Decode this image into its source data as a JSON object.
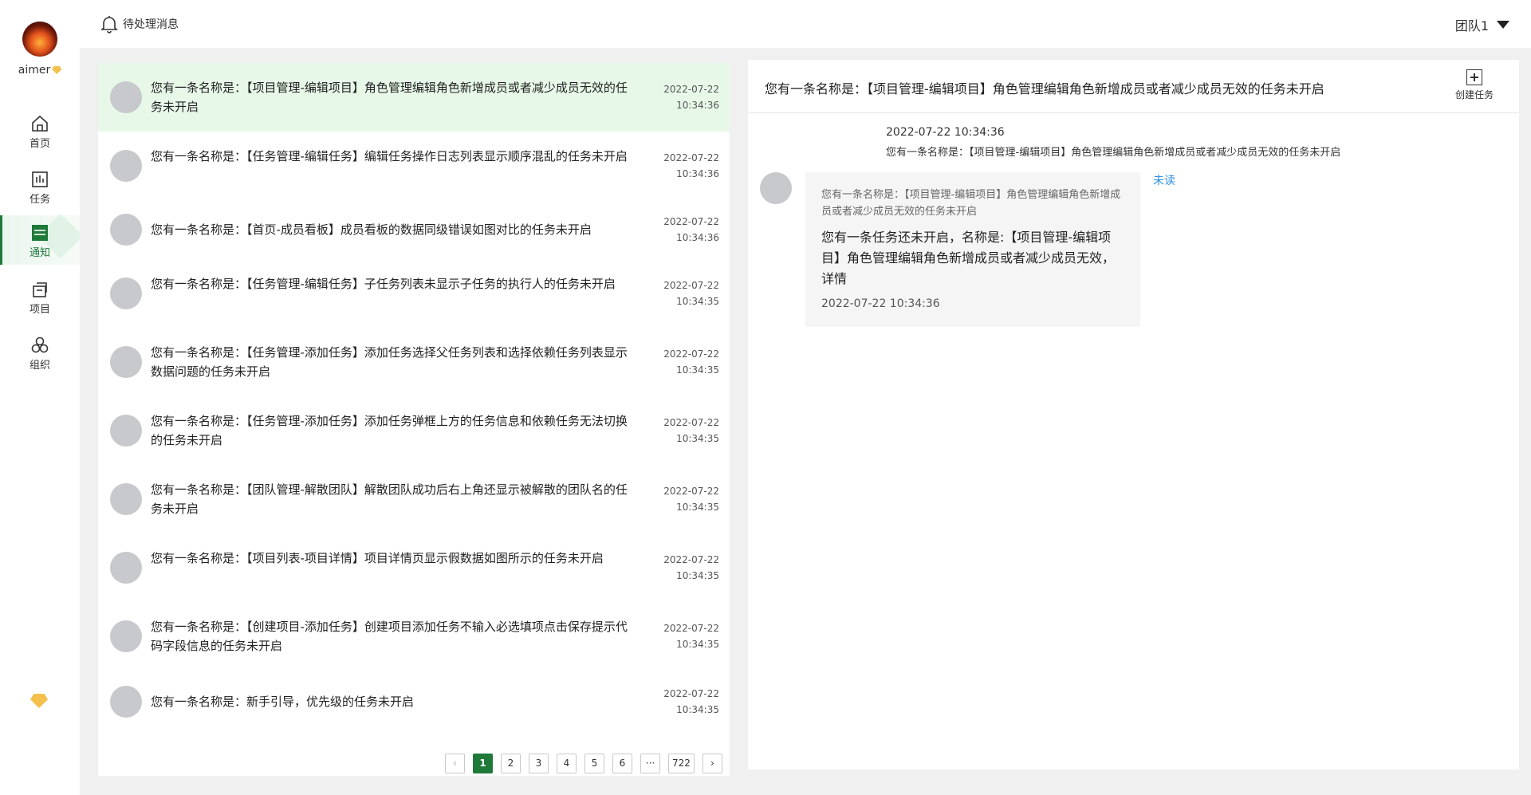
{
  "sidebar": {
    "username": "aimer",
    "nav": [
      {
        "label": "首页",
        "icon": "home-icon"
      },
      {
        "label": "任务",
        "icon": "task-icon"
      },
      {
        "label": "通知",
        "icon": "notification-icon",
        "active": true
      },
      {
        "label": "项目",
        "icon": "project-icon"
      },
      {
        "label": "组织",
        "icon": "organization-icon"
      }
    ]
  },
  "header": {
    "pending_label": "待处理消息",
    "team_label": "团队1"
  },
  "messages": [
    {
      "text": "您有一条名称是：【项目管理-编辑项目】角色管理编辑角色新增成员或者减少成员无效的任务未开启",
      "date": "2022-07-22",
      "time": "10:34:36"
    },
    {
      "text": "您有一条名称是：【任务管理-编辑任务】编辑任务操作日志列表显示顺序混乱的任务未开启",
      "date": "2022-07-22",
      "time": "10:34:36"
    },
    {
      "text": "您有一条名称是：【首页-成员看板】成员看板的数据同级错误如图对比的任务未开启",
      "date": "2022-07-22",
      "time": "10:34:36"
    },
    {
      "text": "您有一条名称是：【任务管理-编辑任务】子任务列表未显示子任务的执行人的任务未开启",
      "date": "2022-07-22",
      "time": "10:34:35"
    },
    {
      "text": "您有一条名称是：【任务管理-添加任务】添加任务选择父任务列表和选择依赖任务列表显示数据问题的任务未开启",
      "date": "2022-07-22",
      "time": "10:34:35"
    },
    {
      "text": "您有一条名称是：【任务管理-添加任务】添加任务弹框上方的任务信息和依赖任务无法切换的任务未开启",
      "date": "2022-07-22",
      "time": "10:34:35"
    },
    {
      "text": "您有一条名称是：【团队管理-解散团队】解散团队成功后右上角还显示被解散的团队名的任务未开启",
      "date": "2022-07-22",
      "time": "10:34:35"
    },
    {
      "text": "您有一条名称是：【项目列表-项目详情】项目详情页显示假数据如图所示的任务未开启",
      "date": "2022-07-22",
      "time": "10:34:35"
    },
    {
      "text": "您有一条名称是：【创建项目-添加任务】创建项目添加任务不输入必选填项点击保存提示代码字段信息的任务未开启",
      "date": "2022-07-22",
      "time": "10:34:35"
    },
    {
      "text": "您有一条名称是：新手引导，优先级的任务未开启",
      "date": "2022-07-22",
      "time": "10:34:35"
    }
  ],
  "pagination": {
    "prev": "‹",
    "pages": [
      "1",
      "2",
      "3",
      "4",
      "5",
      "6",
      "···",
      "722"
    ],
    "current": "1",
    "next": "›"
  },
  "detail": {
    "title": "您有一条名称是：【项目管理-编辑项目】角色管理编辑角色新增成员或者减少成员无效的任务未开启",
    "create_task_label": "创建任务",
    "summary_time": "2022-07-22 10:34:36",
    "summary_text": "您有一条名称是：【项目管理-编辑项目】角色管理编辑角色新增成员或者减少成员无效的任务未开启",
    "bubble_sub": "您有一条名称是：【项目管理-编辑项目】角色管理编辑角色新增成员或者减少成员无效的任务未开启",
    "bubble_main": "您有一条任务还未开启，名称是:【项目管理-编辑项目】角色管理编辑角色新增成员或者减少成员无效，详情",
    "bubble_time": "2022-07-22 10:34:36",
    "unread_label": "未读"
  },
  "colors": {
    "accent": "#1f7a3a",
    "active_row": "#e7f8e9",
    "unread": "#2e8fe6"
  }
}
